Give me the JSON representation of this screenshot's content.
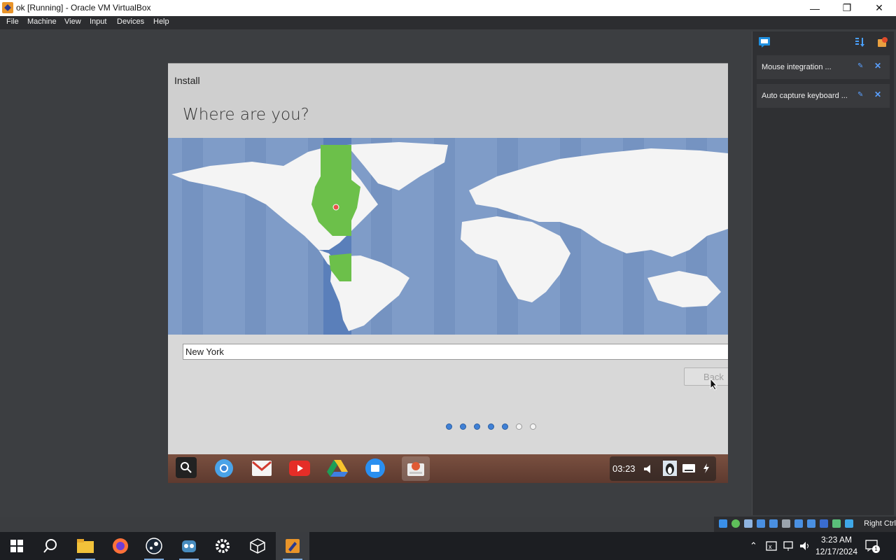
{
  "window": {
    "title": "ok [Running] - Oracle VM VirtualBox",
    "minimize_glyph": "—",
    "restore_glyph": "❐",
    "close_glyph": "✕"
  },
  "menu": [
    "File",
    "Machine",
    "View",
    "Input",
    "Devices",
    "Help"
  ],
  "notifications": [
    {
      "text": "Mouse integration ..."
    },
    {
      "text": "Auto capture keyboard ..."
    }
  ],
  "installer": {
    "header": "Install",
    "title": "Where are you?",
    "location_value": "New York",
    "back_label": "Back",
    "progress_steps": [
      true,
      true,
      true,
      true,
      true,
      false,
      false
    ]
  },
  "guest_shelf": {
    "time": "03:23",
    "apps": [
      "search-icon",
      "chrome-icon",
      "gmail-icon",
      "youtube-icon",
      "drive-icon",
      "files-icon",
      "installer-icon"
    ]
  },
  "vm_status": {
    "host_key": "Right Ctrl"
  },
  "taskbar": {
    "time": "3:23 AM",
    "date": "12/17/2024",
    "notification_count": "1"
  }
}
